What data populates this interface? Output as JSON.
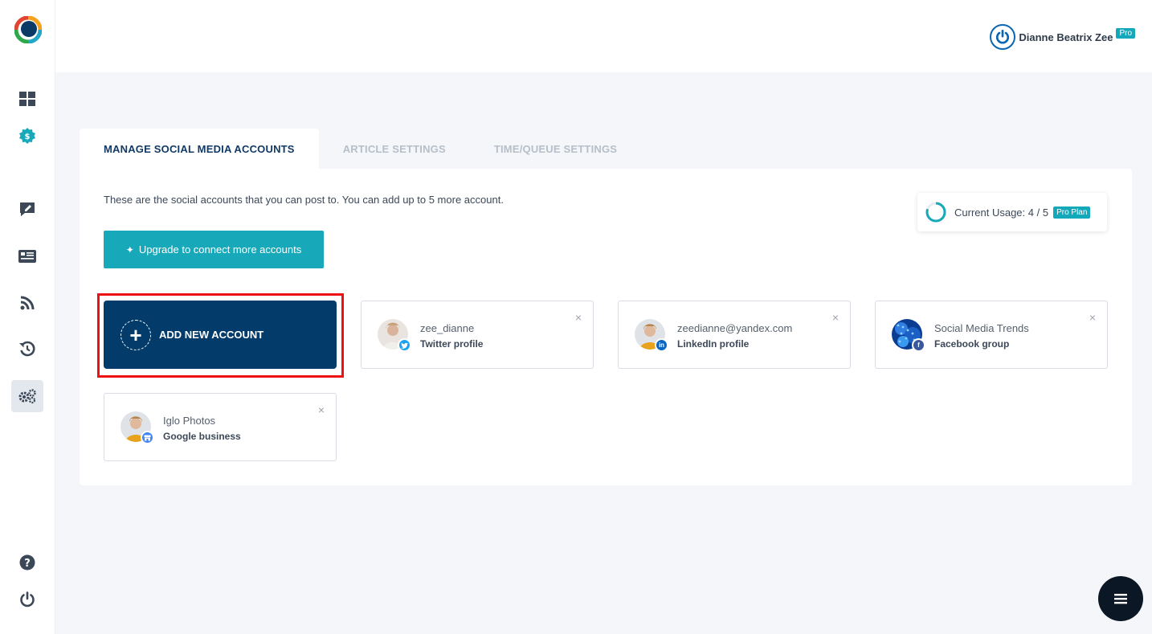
{
  "user": {
    "name": "Dianne Beatrix Zee",
    "badge": "Pro"
  },
  "sidebar": {
    "items": [
      {
        "icon": "dashboard-icon"
      },
      {
        "icon": "dollar-badge-icon"
      },
      {
        "icon": "compose-icon"
      },
      {
        "icon": "articles-icon"
      },
      {
        "icon": "rss-icon"
      },
      {
        "icon": "history-icon"
      },
      {
        "icon": "settings-gears-icon",
        "active": true
      },
      {
        "icon": "help-icon"
      },
      {
        "icon": "power-icon"
      }
    ]
  },
  "tabs": [
    {
      "label": "MANAGE SOCIAL MEDIA ACCOUNTS",
      "active": true
    },
    {
      "label": "ARTICLE SETTINGS",
      "active": false
    },
    {
      "label": "TIME/QUEUE SETTINGS",
      "active": false
    }
  ],
  "main": {
    "info_text": "These are the social accounts that you can post to. You can add up to 5 more account.",
    "usage_label": "Current Usage: 4 / 5",
    "usage_fraction": 0.8,
    "plan_badge": "Pro Plan",
    "upgrade_label": "Upgrade to connect more accounts",
    "add_account_label": "ADD NEW ACCOUNT",
    "close_symbol": "×",
    "accounts": [
      {
        "name": "zee_dianne",
        "type": "Twitter profile",
        "network": "twitter",
        "network_color": "#1da1f2"
      },
      {
        "name": "zeedianne@yandex.com",
        "type": "LinkedIn profile",
        "network": "linkedin",
        "network_color": "#0a66c2"
      },
      {
        "name": "Social Media Trends",
        "type": "Facebook group",
        "network": "facebook",
        "network_color": "#3b5998"
      },
      {
        "name": "Iglo Photos",
        "type": "Google business",
        "network": "google-business",
        "network_color": "#4285f4"
      }
    ]
  },
  "colors": {
    "accent": "#17a9b9",
    "primary": "#033c6b",
    "highlight": "#ee1111"
  }
}
